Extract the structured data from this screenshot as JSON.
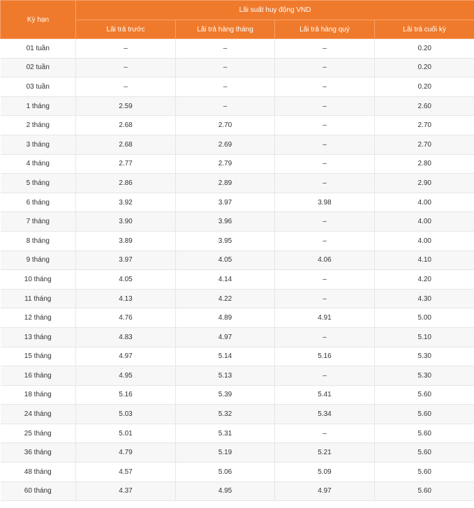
{
  "header": {
    "term_label": "Kỳ hạn",
    "group_label": "Lãi suất huy động VND",
    "columns": [
      "Lãi trả trước",
      "Lãi trả hàng tháng",
      "Lãi trả hàng quý",
      "Lãi trả cuối kỳ"
    ]
  },
  "colors": {
    "header_bg": "#f07a2c",
    "header_text": "#ffffff",
    "row_alt_bg": "#f7f7f7"
  },
  "rows": [
    [
      "01 tuần",
      "–",
      "–",
      "–",
      "0.20"
    ],
    [
      "02 tuần",
      "–",
      "–",
      "–",
      "0.20"
    ],
    [
      "03 tuần",
      "–",
      "–",
      "–",
      "0.20"
    ],
    [
      "1 tháng",
      "2.59",
      "–",
      "–",
      "2.60"
    ],
    [
      "2 tháng",
      "2.68",
      "2.70",
      "–",
      "2.70"
    ],
    [
      "3 tháng",
      "2.68",
      "2.69",
      "–",
      "2.70"
    ],
    [
      "4 tháng",
      "2.77",
      "2.79",
      "–",
      "2.80"
    ],
    [
      "5 tháng",
      "2.86",
      "2.89",
      "–",
      "2.90"
    ],
    [
      "6 tháng",
      "3.92",
      "3.97",
      "3.98",
      "4.00"
    ],
    [
      "7 tháng",
      "3.90",
      "3.96",
      "–",
      "4.00"
    ],
    [
      "8 tháng",
      "3.89",
      "3.95",
      "–",
      "4.00"
    ],
    [
      "9 tháng",
      "3.97",
      "4.05",
      "4.06",
      "4.10"
    ],
    [
      "10 tháng",
      "4.05",
      "4.14",
      "–",
      "4.20"
    ],
    [
      "11 tháng",
      "4.13",
      "4.22",
      "–",
      "4.30"
    ],
    [
      "12 tháng",
      "4.76",
      "4.89",
      "4.91",
      "5.00"
    ],
    [
      "13 tháng",
      "4.83",
      "4.97",
      "–",
      "5.10"
    ],
    [
      "15 tháng",
      "4.97",
      "5.14",
      "5.16",
      "5.30"
    ],
    [
      "16 tháng",
      "4.95",
      "5.13",
      "–",
      "5.30"
    ],
    [
      "18 tháng",
      "5.16",
      "5.39",
      "5.41",
      "5.60"
    ],
    [
      "24 tháng",
      "5.03",
      "5.32",
      "5.34",
      "5.60"
    ],
    [
      "25 tháng",
      "5.01",
      "5.31",
      "–",
      "5.60"
    ],
    [
      "36 tháng",
      "4.79",
      "5.19",
      "5.21",
      "5.60"
    ],
    [
      "48 tháng",
      "4.57",
      "5.06",
      "5.09",
      "5.60"
    ],
    [
      "60 tháng",
      "4.37",
      "4.95",
      "4.97",
      "5.60"
    ]
  ]
}
